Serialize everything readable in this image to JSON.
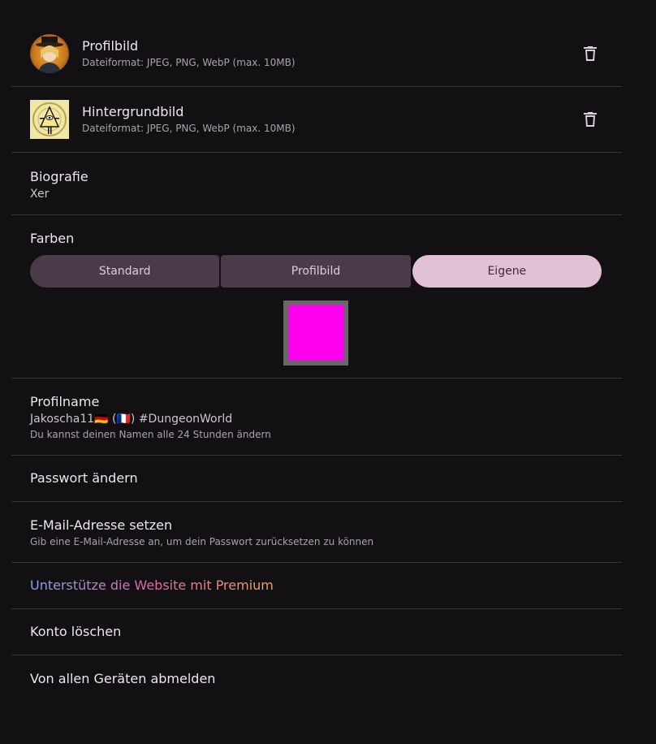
{
  "profile_picture": {
    "title": "Profilbild",
    "subtitle": "Dateiformat: JPEG, PNG, WebP (max. 10MB)"
  },
  "background_picture": {
    "title": "Hintergrundbild",
    "subtitle": "Dateiformat: JPEG, PNG, WebP (max. 10MB)"
  },
  "biography": {
    "title": "Biografie",
    "value": "Xer"
  },
  "colors": {
    "title": "Farben",
    "options": [
      "Standard",
      "Profilbild",
      "Eigene"
    ],
    "selected": "Eigene",
    "custom_color": "#ff00ee"
  },
  "profile_name": {
    "title": "Profilname",
    "value": "Jakoscha11🇩🇪 (🇫🇷) #DungeonWorld",
    "hint": "Du kannst deinen Namen alle 24 Stunden ändern"
  },
  "password": {
    "title": "Passwort ändern"
  },
  "email": {
    "title": "E-Mail-Adresse setzen",
    "hint": "Gib eine E-Mail-Adresse an, um dein Passwort zurücksetzen zu können"
  },
  "premium": {
    "text": "Unterstütze die Website mit Premium",
    "gradient_colors": [
      "#7fa6f0",
      "#e06aa8",
      "#f2a65a"
    ]
  },
  "delete_account": {
    "title": "Konto löschen"
  },
  "logout_all": {
    "title": "Von allen Geräten abmelden"
  },
  "icons": {
    "delete": "trash-icon"
  }
}
